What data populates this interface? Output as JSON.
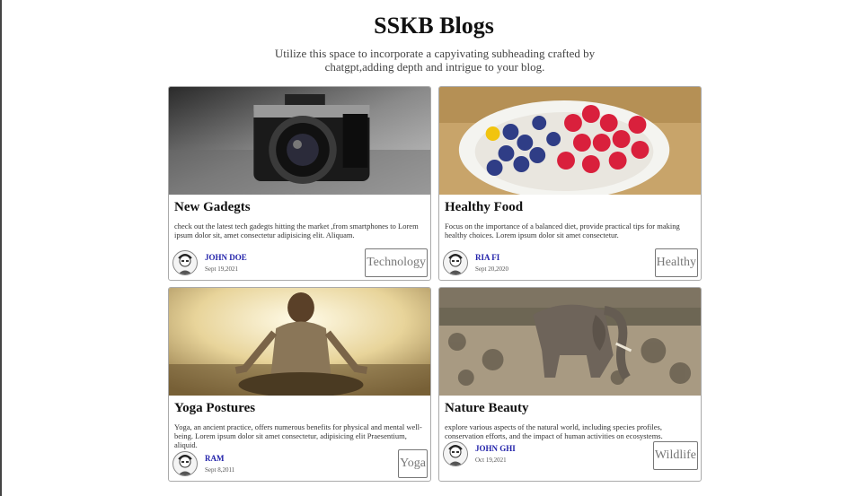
{
  "header": {
    "title": "SSKB Blogs",
    "subtitle": "Utilize this space to incorporate a capyivating subheading crafted by chatgpt,adding depth and intrigue to your blog."
  },
  "posts": [
    {
      "title": "New Gadegts",
      "description": "check out the latest tech gadegts hitting the market ,from smartphones to Lorem ipsum dolor sit, amet consectetur adipisicing elit. Aliquam.",
      "author": "JOHN DOE",
      "date": "Sept 19,2021",
      "tag": "Technology",
      "image": "camera-photo"
    },
    {
      "title": "Healthy Food",
      "description": "Focus on the importance of a balanced diet, provide practical tips for making healthy choices. Lorem ipsum dolor sit amet consectetur.",
      "author": "RIA FI",
      "date": "Sept 20,2020",
      "tag": "Healthy",
      "image": "berries-photo"
    },
    {
      "title": "Yoga Postures",
      "description": "Yoga, an ancient practice, offers numerous benefits for physical and mental well-being. Lorem ipsum dolor sit amet consectetur, adipisicing elit Praesentium, aliquid.",
      "author": "RAM",
      "date": "Sept 8,2011",
      "tag": "Yoga",
      "image": "yoga-photo"
    },
    {
      "title": "Nature Beauty",
      "description": "explore various aspects of the natural world, including species profiles, conservation efforts, and the impact of human activities on ecosystems.",
      "author": "JOHN GHI",
      "date": "Oct 19,2021",
      "tag": "Wildlife",
      "image": "elephant-photo"
    }
  ]
}
